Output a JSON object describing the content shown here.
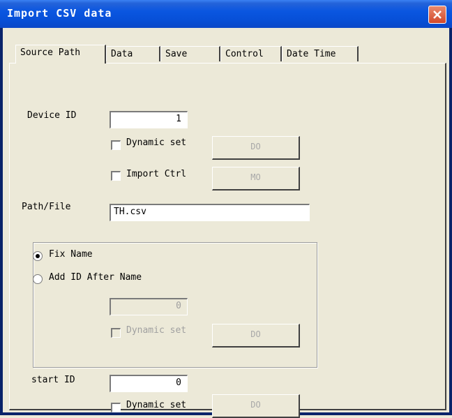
{
  "window": {
    "title": "Import CSV data",
    "close_icon": "close-icon"
  },
  "tabs": [
    {
      "label": "Source Path",
      "active": true
    },
    {
      "label": "Data"
    },
    {
      "label": "Save"
    },
    {
      "label": "Control"
    },
    {
      "label": "Date Time"
    }
  ],
  "device": {
    "label": "Device ID",
    "value": "1",
    "dynamic_set_label": "Dynamic set",
    "do_button": "DO",
    "import_ctrl_label": "Import Ctrl",
    "mo_button": "MO"
  },
  "path": {
    "label": "Path/File",
    "value": "TH.csv"
  },
  "naming": {
    "fix_name_label": "Fix Name",
    "add_id_label": "Add ID After Name",
    "id_value": "0",
    "dynamic_set_label": "Dynamic set",
    "do_button": "DO"
  },
  "start": {
    "label": "start ID",
    "value": "0",
    "dynamic_set_label": "Dynamic set",
    "do_button": "DO"
  }
}
